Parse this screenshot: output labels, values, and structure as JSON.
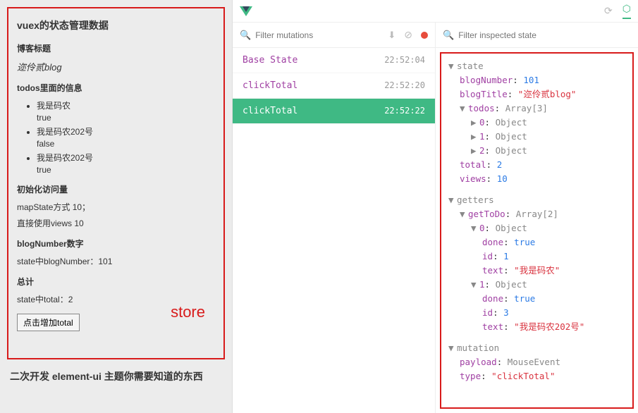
{
  "left": {
    "title": "vuex的状态管理数据",
    "section_blog_title": "博客标题",
    "blog_name": "迩伶贰blog",
    "section_todos": "todos里面的信息",
    "todos": [
      {
        "text": "我是码农",
        "val": "true"
      },
      {
        "text": "我是码农202号",
        "val": "false"
      },
      {
        "text": "我是码农202号",
        "val": "true"
      }
    ],
    "section_views": "初始化访问量",
    "views_line1": "mapState方式 10；",
    "views_line2": "直接使用views 10",
    "section_blognumber": "blogNumber数字",
    "blognumber_line": "state中blogNumber：101",
    "section_total": "总计",
    "total_line": "state中total：2",
    "store_label": "store",
    "button": "点击增加total",
    "footer_title": "二次开发 element-ui 主题你需要知道的东西"
  },
  "devtools": {
    "filter_mutations_placeholder": "Filter mutations",
    "filter_state_placeholder": "Filter inspected state",
    "mutations": [
      {
        "name": "Base State",
        "time": "22:52:04",
        "active": false
      },
      {
        "name": "clickTotal",
        "time": "22:52:20",
        "active": false
      },
      {
        "name": "clickTotal",
        "time": "22:52:22",
        "active": true
      }
    ],
    "state": {
      "sec": "state",
      "blogNumber_k": "blogNumber",
      "blogNumber_v": "101",
      "blogTitle_k": "blogTitle",
      "blogTitle_v": "\"迩伶贰blog\"",
      "todos_k": "todos",
      "todos_v": "Array[3]",
      "t0_k": "0",
      "t0_v": "Object",
      "t1_k": "1",
      "t1_v": "Object",
      "t2_k": "2",
      "t2_v": "Object",
      "total_k": "total",
      "total_v": "2",
      "views_k": "views",
      "views_v": "10"
    },
    "getters": {
      "sec": "getters",
      "getToDo_k": "getToDo",
      "getToDo_v": "Array[2]",
      "g0_k": "0",
      "g0_v": "Object",
      "g0_done_k": "done",
      "g0_done_v": "true",
      "g0_id_k": "id",
      "g0_id_v": "1",
      "g0_text_k": "text",
      "g0_text_v": "\"我是码农\"",
      "g1_k": "1",
      "g1_v": "Object",
      "g1_done_k": "done",
      "g1_done_v": "true",
      "g1_id_k": "id",
      "g1_id_v": "3",
      "g1_text_k": "text",
      "g1_text_v": "\"我是码农202号\""
    },
    "mutation": {
      "sec": "mutation",
      "payload_k": "payload",
      "payload_v": "MouseEvent",
      "type_k": "type",
      "type_v": "\"clickTotal\""
    }
  }
}
